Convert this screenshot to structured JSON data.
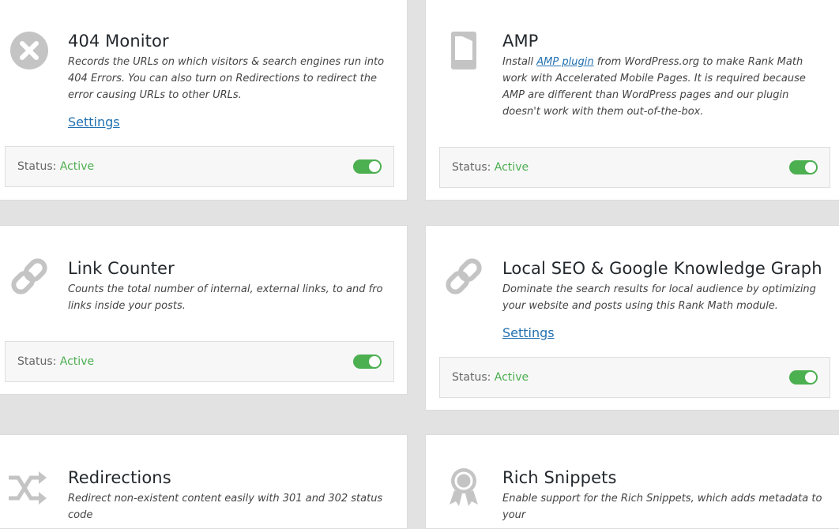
{
  "modules": [
    {
      "title": "404 Monitor",
      "icon": "close-circle-icon",
      "description": "Records the URLs on which visitors & search engines run into 404 Errors. You can also turn on Redirections to redirect the error causing URLs to other URLs.",
      "settings_label": "Settings",
      "status_label": "Status:",
      "status_value": "Active",
      "enabled": true
    },
    {
      "title": "AMP",
      "icon": "mobile-device-icon",
      "description_before": "Install ",
      "description_link": "AMP plugin",
      "description_after": " from WordPress.org to make Rank Math work with Accelerated Mobile Pages. It is required because AMP are different than WordPress pages and our plugin doesn't work with them out-of-the-box.",
      "status_label": "Status:",
      "status_value": "Active",
      "enabled": true
    },
    {
      "title": "Link Counter",
      "icon": "link-icon",
      "description": "Counts the total number of internal, external links, to and fro links inside your posts.",
      "status_label": "Status:",
      "status_value": "Active",
      "enabled": true
    },
    {
      "title": "Local SEO & Google Knowledge Graph",
      "icon": "link-icon",
      "description": "Dominate the search results for local audience by optimizing your website and posts using this Rank Math module.",
      "settings_label": "Settings",
      "status_label": "Status:",
      "status_value": "Active",
      "enabled": true
    },
    {
      "title": "Redirections",
      "icon": "shuffle-icon",
      "description": "Redirect non-existent content easily with 301 and 302 status code"
    },
    {
      "title": "Rich Snippets",
      "icon": "award-badge-icon",
      "description": "Enable support for the Rich Snippets, which adds metadata to your"
    }
  ],
  "colors": {
    "page_bg": "#e2e2e2",
    "icon_gray": "#c4c4c4",
    "link_blue": "#2271b1",
    "active_green": "#4caf50"
  }
}
